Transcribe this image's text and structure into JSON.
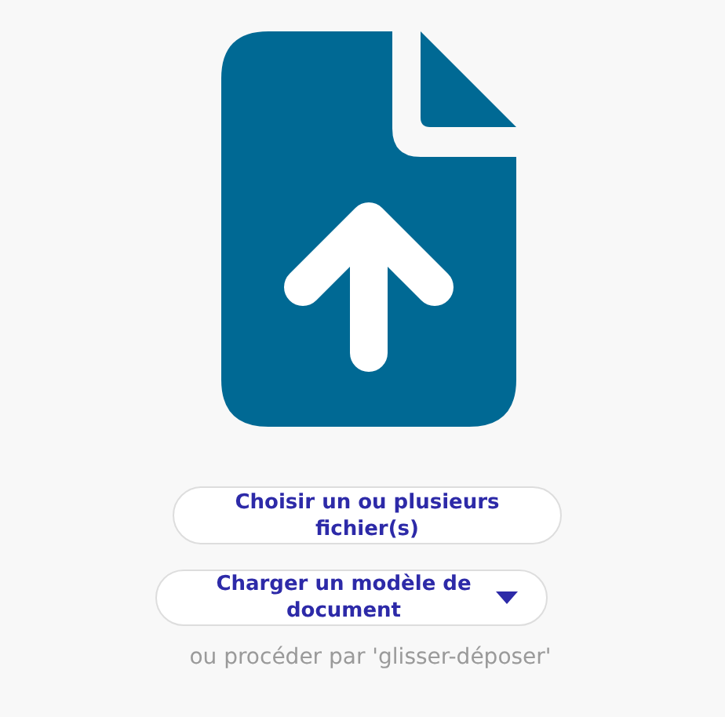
{
  "buttons": [
    {
      "kind": "plain",
      "label": "Choisir un ou plusieurs fichier(s)"
    },
    {
      "kind": "dropdown",
      "label": "Charger un modèle de document"
    }
  ],
  "hint": "ou procéder par 'glisser-déposer'"
}
